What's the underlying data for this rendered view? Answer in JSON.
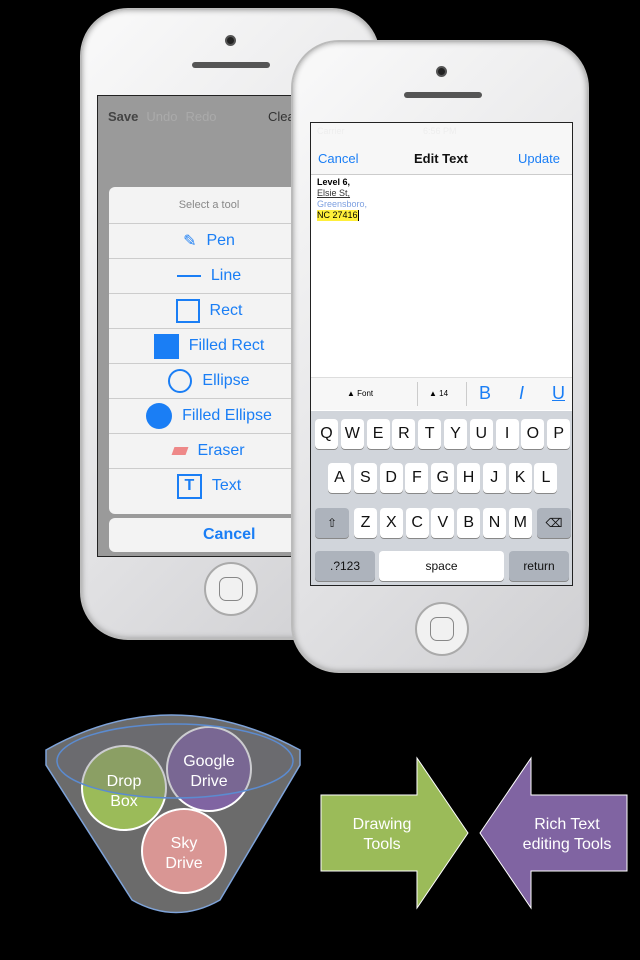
{
  "back_phone": {
    "toolbar": {
      "save": "Save",
      "undo": "Undo",
      "redo": "Redo",
      "clear": "Clea"
    },
    "sheet": {
      "title": "Select a tool",
      "items": [
        {
          "label": "Pen",
          "icon": "pen-icon"
        },
        {
          "label": "Line",
          "icon": "line-icon"
        },
        {
          "label": "Rect",
          "icon": "rect-icon"
        },
        {
          "label": "Filled Rect",
          "icon": "filled-rect-icon"
        },
        {
          "label": "Ellipse",
          "icon": "ellipse-icon"
        },
        {
          "label": "Filled Ellipse",
          "icon": "filled-ellipse-icon"
        },
        {
          "label": "Eraser",
          "icon": "eraser-icon"
        },
        {
          "label": "Text",
          "icon": "text-icon"
        }
      ],
      "cancel": "Cancel"
    }
  },
  "front_phone": {
    "status": {
      "carrier": "Carrier",
      "time": "6:56 PM"
    },
    "nav": {
      "cancel": "Cancel",
      "title": "Edit Text",
      "update": "Update"
    },
    "text_lines": [
      "Level 6,",
      "Elsie St,",
      "Greensboro,",
      "NC 27416"
    ],
    "format_bar": {
      "font": "Font",
      "size": "14",
      "bold": "B",
      "italic": "I",
      "underline": "U"
    },
    "keyboard": {
      "row1": [
        "Q",
        "W",
        "E",
        "R",
        "T",
        "Y",
        "U",
        "I",
        "O",
        "P"
      ],
      "row2": [
        "A",
        "S",
        "D",
        "F",
        "G",
        "H",
        "J",
        "K",
        "L"
      ],
      "row3": [
        "Z",
        "X",
        "C",
        "V",
        "B",
        "N",
        "M"
      ],
      "numbers": ".?123",
      "space": "space",
      "return": "return"
    }
  },
  "diagram": {
    "funnel_items": [
      "Drop",
      "Box",
      "Google",
      "Drive",
      "Sky",
      "Drive"
    ],
    "arrow_left": [
      "Drawing",
      "Tools"
    ],
    "arrow_right": [
      "Rich Text",
      "editing Tools"
    ],
    "colors": {
      "green": "#9bbb59",
      "purple": "#8064a2",
      "pink": "#d99694",
      "funnel": "#6b6b6b",
      "accent": "#1a7ef5"
    }
  }
}
